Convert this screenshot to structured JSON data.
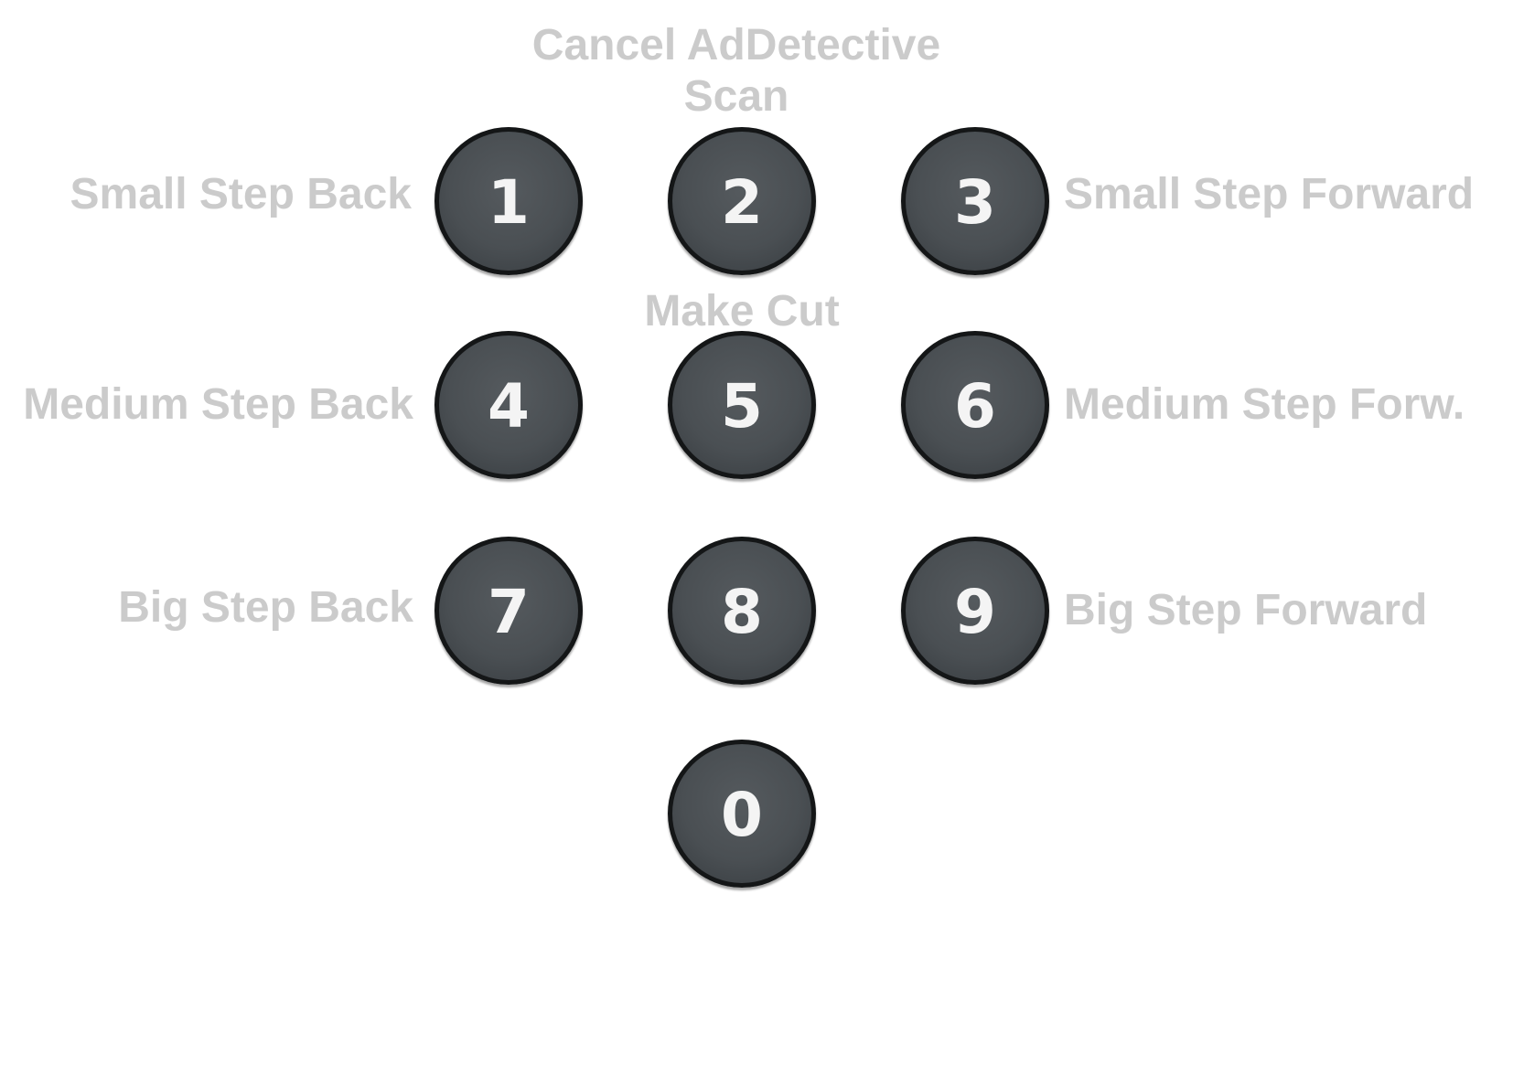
{
  "keypad": {
    "keys": [
      {
        "digit": "1",
        "action": "Small Step Back"
      },
      {
        "digit": "2",
        "action": "Cancel AdDetective Scan"
      },
      {
        "digit": "3",
        "action": "Small Step Forward"
      },
      {
        "digit": "4",
        "action": "Medium Step Back"
      },
      {
        "digit": "5",
        "action": "Make Cut"
      },
      {
        "digit": "6",
        "action": "Medium Step Forw."
      },
      {
        "digit": "7",
        "action": "Big Step Back"
      },
      {
        "digit": "8",
        "action": ""
      },
      {
        "digit": "9",
        "action": "Big Step Forward"
      },
      {
        "digit": "0",
        "action": ""
      }
    ],
    "labels": {
      "cancel_scan_line1": "Cancel AdDetective",
      "cancel_scan_line2": "Scan",
      "small_step_back": "Small Step Back",
      "small_step_forward": "Small Step Forward",
      "make_cut": "Make Cut",
      "medium_step_back": "Medium Step Back",
      "medium_step_forward": "Medium Step Forw.",
      "big_step_back": "Big Step Back",
      "big_step_forward": "Big Step Forward"
    },
    "colors": {
      "label_text": "#cbcbcb",
      "key_face": "#4a4f53",
      "key_rim": "#141617",
      "digit_text": "#f4f4f4",
      "background": "#ffffff"
    }
  }
}
